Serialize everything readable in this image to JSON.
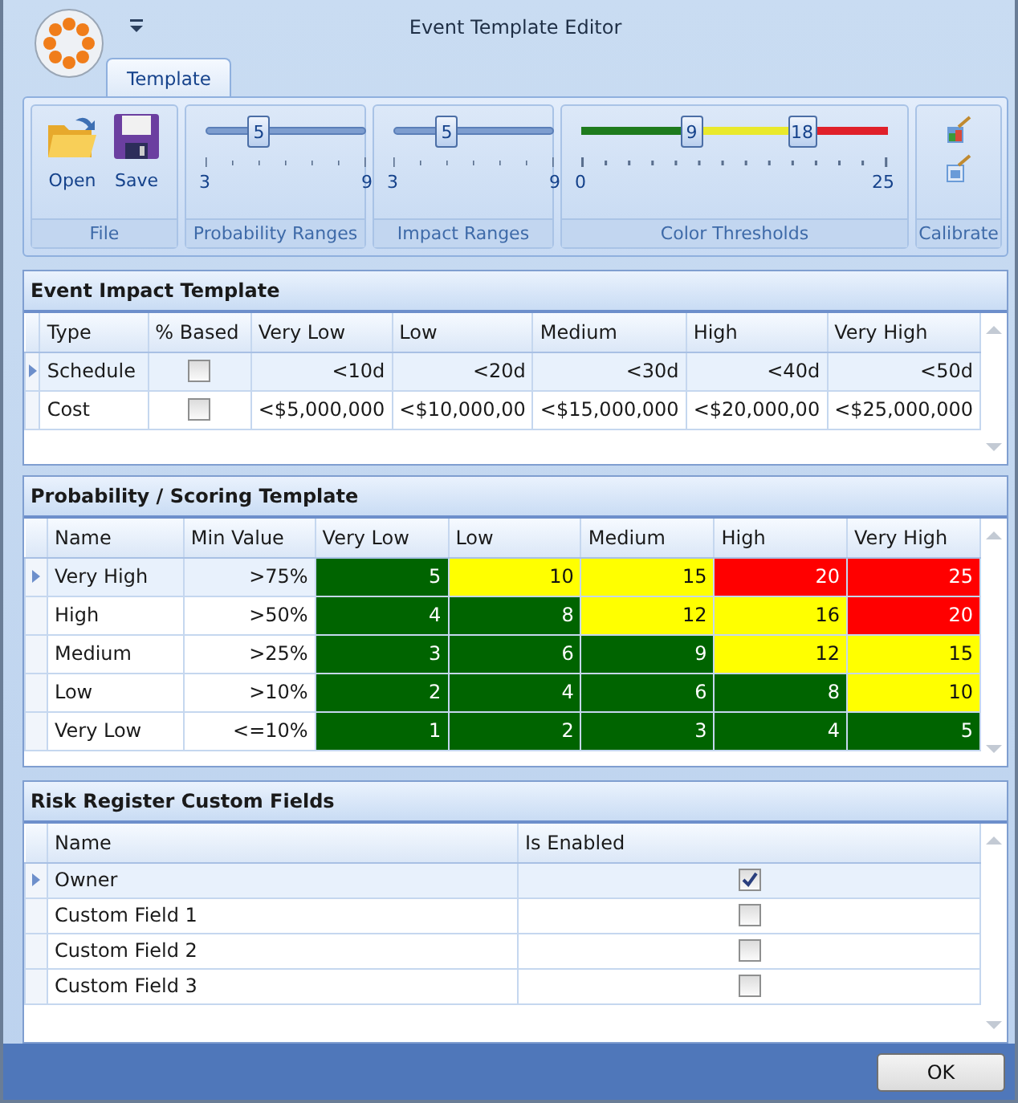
{
  "window": {
    "title": "Event Template Editor"
  },
  "tabs": [
    {
      "label": "Template",
      "selected": true
    }
  ],
  "ribbon": {
    "groups": [
      {
        "kind": "file",
        "label": "File",
        "buttons": [
          {
            "kind": "open",
            "label": "Open"
          },
          {
            "kind": "save",
            "label": "Save"
          }
        ]
      },
      {
        "kind": "slider",
        "label": "Probability Ranges",
        "min": "3",
        "max": "9",
        "thumbs": [
          {
            "value": "5",
            "level": 0.333
          }
        ]
      },
      {
        "kind": "slider",
        "label": "Impact Ranges",
        "min": "3",
        "max": "9",
        "thumbs": [
          {
            "value": "5",
            "level": 0.333
          }
        ]
      },
      {
        "kind": "thresholds",
        "label": "Color Thresholds",
        "min": "0",
        "max": "25",
        "thumbs": [
          {
            "value": "9",
            "level": 0.36
          },
          {
            "value": "18",
            "level": 0.72
          }
        ],
        "segments": [
          {
            "color": "#1e7b1e"
          },
          {
            "color": "#e9e92c"
          },
          {
            "color": "#e0202a"
          }
        ]
      },
      {
        "kind": "calibrate",
        "label": "Calibrate"
      }
    ]
  },
  "impact": {
    "title": "Event Impact Template",
    "columns": [
      "Type",
      "% Based",
      "Very Low",
      "Low",
      "Medium",
      "High",
      "Very High"
    ],
    "rows": [
      {
        "selected": true,
        "cells": [
          {
            "kind": "text",
            "text": "Schedule"
          },
          {
            "kind": "check",
            "checked": false
          },
          {
            "kind": "num",
            "text": "<10d"
          },
          {
            "kind": "num",
            "text": "<20d"
          },
          {
            "kind": "num",
            "text": "<30d"
          },
          {
            "kind": "num",
            "text": "<40d"
          },
          {
            "kind": "num",
            "text": "<50d"
          }
        ]
      },
      {
        "selected": false,
        "cells": [
          {
            "kind": "text",
            "text": "Cost"
          },
          {
            "kind": "check",
            "checked": false
          },
          {
            "kind": "num",
            "text": "<$5,000,000"
          },
          {
            "kind": "num",
            "text": "<$10,000,00"
          },
          {
            "kind": "num",
            "text": "<$15,000,000"
          },
          {
            "kind": "num",
            "text": "<$20,000,00"
          },
          {
            "kind": "num",
            "text": "<$25,000,000"
          }
        ]
      }
    ]
  },
  "probability": {
    "title": "Probability / Scoring Template",
    "columns": [
      "Name",
      "Min Value",
      "Very Low",
      "Low",
      "Medium",
      "High",
      "Very High"
    ],
    "rows": [
      {
        "selected": true,
        "cells": [
          {
            "kind": "text",
            "text": "Very High"
          },
          {
            "kind": "num",
            "text": ">75%"
          },
          {
            "kind": "score",
            "value": "5",
            "color": "#006400"
          },
          {
            "kind": "score",
            "value": "10",
            "color": "#ffff00"
          },
          {
            "kind": "score",
            "value": "15",
            "color": "#ffff00"
          },
          {
            "kind": "score",
            "value": "20",
            "color": "#ff0000"
          },
          {
            "kind": "score",
            "value": "25",
            "color": "#ff0000"
          }
        ]
      },
      {
        "selected": false,
        "cells": [
          {
            "kind": "text",
            "text": "High"
          },
          {
            "kind": "num",
            "text": ">50%"
          },
          {
            "kind": "score",
            "value": "4",
            "color": "#006400"
          },
          {
            "kind": "score",
            "value": "8",
            "color": "#006400"
          },
          {
            "kind": "score",
            "value": "12",
            "color": "#ffff00"
          },
          {
            "kind": "score",
            "value": "16",
            "color": "#ffff00"
          },
          {
            "kind": "score",
            "value": "20",
            "color": "#ff0000"
          }
        ]
      },
      {
        "selected": false,
        "cells": [
          {
            "kind": "text",
            "text": "Medium"
          },
          {
            "kind": "num",
            "text": ">25%"
          },
          {
            "kind": "score",
            "value": "3",
            "color": "#006400"
          },
          {
            "kind": "score",
            "value": "6",
            "color": "#006400"
          },
          {
            "kind": "score",
            "value": "9",
            "color": "#006400"
          },
          {
            "kind": "score",
            "value": "12",
            "color": "#ffff00"
          },
          {
            "kind": "score",
            "value": "15",
            "color": "#ffff00"
          }
        ]
      },
      {
        "selected": false,
        "cells": [
          {
            "kind": "text",
            "text": "Low"
          },
          {
            "kind": "num",
            "text": ">10%"
          },
          {
            "kind": "score",
            "value": "2",
            "color": "#006400"
          },
          {
            "kind": "score",
            "value": "4",
            "color": "#006400"
          },
          {
            "kind": "score",
            "value": "6",
            "color": "#006400"
          },
          {
            "kind": "score",
            "value": "8",
            "color": "#006400"
          },
          {
            "kind": "score",
            "value": "10",
            "color": "#ffff00"
          }
        ]
      },
      {
        "selected": false,
        "cells": [
          {
            "kind": "text",
            "text": "Very Low"
          },
          {
            "kind": "num",
            "text": "<=10%"
          },
          {
            "kind": "score",
            "value": "1",
            "color": "#006400"
          },
          {
            "kind": "score",
            "value": "2",
            "color": "#006400"
          },
          {
            "kind": "score",
            "value": "3",
            "color": "#006400"
          },
          {
            "kind": "score",
            "value": "4",
            "color": "#006400"
          },
          {
            "kind": "score",
            "value": "5",
            "color": "#006400"
          }
        ]
      }
    ]
  },
  "custom_fields": {
    "title": "Risk Register Custom Fields",
    "columns": [
      "Name",
      "Is Enabled"
    ],
    "rows": [
      {
        "selected": true,
        "cells": [
          {
            "kind": "text",
            "text": "Owner"
          },
          {
            "kind": "check",
            "checked": true
          }
        ]
      },
      {
        "selected": false,
        "cells": [
          {
            "kind": "text",
            "text": "Custom Field 1"
          },
          {
            "kind": "check",
            "checked": false
          }
        ]
      },
      {
        "selected": false,
        "cells": [
          {
            "kind": "text",
            "text": "Custom Field 2"
          },
          {
            "kind": "check",
            "checked": false
          }
        ]
      },
      {
        "selected": false,
        "cells": [
          {
            "kind": "text",
            "text": "Custom Field 3"
          },
          {
            "kind": "check",
            "checked": false
          }
        ]
      }
    ]
  },
  "buttons": [
    {
      "label": "OK"
    }
  ]
}
